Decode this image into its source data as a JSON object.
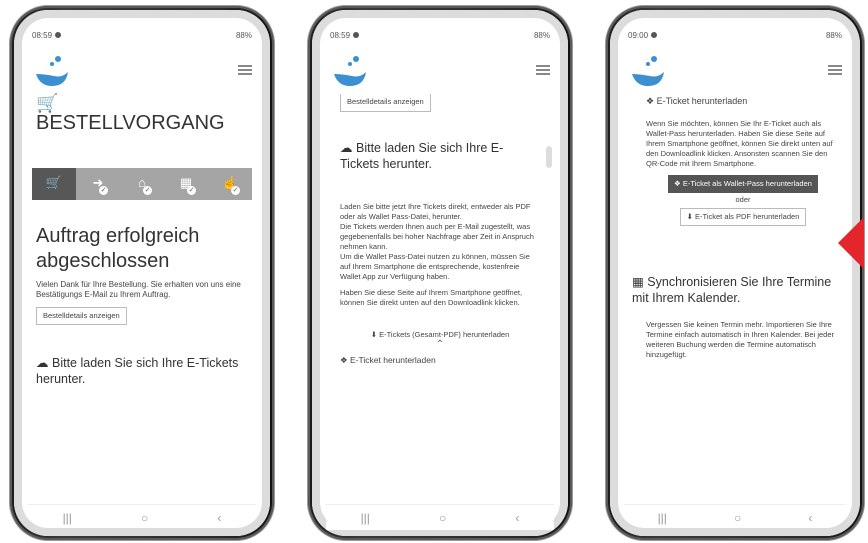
{
  "phones": [
    {
      "time": "08:59",
      "battery": "88%",
      "title": "BESTELLVORGANG",
      "heading": "Auftrag erfolgreich abgeschlossen",
      "thanks": "Vielen Dank für Ihre Bestellung. Sie erhalten von uns eine Bestätigungs E-Mail zu Ihrem Auftrag.",
      "details_button": "Bestelldetails anzeigen",
      "download_heading": "Bitte laden Sie sich Ihre E-Tickets herunter."
    },
    {
      "time": "08:59",
      "battery": "88%",
      "details_button": "Bestelldetails anzeigen",
      "download_heading": "Bitte laden Sie sich Ihre E-Tickets herunter.",
      "para1": "Laden Sie bitte jetzt Ihre Tickets direkt, entweder als PDF oder als Wallet Pass-Datei, herunter.",
      "para2": "Die Tickets werden Ihnen auch per E-Mail zugestellt, was gegebenenfalls bei hoher Nachfrage aber Zeit in Anspruch nehmen kann.",
      "para3": "Um die Wallet Pass-Datei nutzen zu können, müssen Sie auf Ihrem Smartphone die entsprechende, kostenfreie Wallet App zur Verfügung haben.",
      "para4": "Haben Sie diese Seite auf Ihrem Smartphone geöffnet, können Sie direkt unten auf den Downloadlink klicken.",
      "download_link": "E-Tickets (Gesamt-PDF) herunterladen",
      "next_heading": "E-Ticket herunterladen"
    },
    {
      "time": "09:00",
      "battery": "88%",
      "ticket_heading": "E-Ticket herunterladen",
      "ticket_text": "Wenn Sie möchten, können Sie Ihr E-Ticket auch als Wallet-Pass herunterladen. Haben Sie diese Seite auf Ihrem Smartphone geöffnet, können Sie direkt unten auf den Downloadlink klicken. Ansonsten scannen Sie den QR-Code mit Ihrem Smartphone.",
      "wallet_button": "E-Ticket als Wallet-Pass herunterladen",
      "or": "oder",
      "pdf_button": "E-Ticket als PDF herunterladen",
      "sync_heading": "Synchronisieren Sie Ihre Termine mit Ihrem Kalender.",
      "sync_text": "Vergessen Sie keinen Termin mehr. Importieren Sie Ihre Termine einfach automatisch in Ihren Kalender. Bei jeder weiteren Buchung werden die Termine automatisch hinzugefügt."
    }
  ],
  "colors": {
    "accent_blue": "#3c8fd1",
    "arrow_red": "#e3262b",
    "step_active": "#575757",
    "step_inactive": "#a5a5a5"
  }
}
